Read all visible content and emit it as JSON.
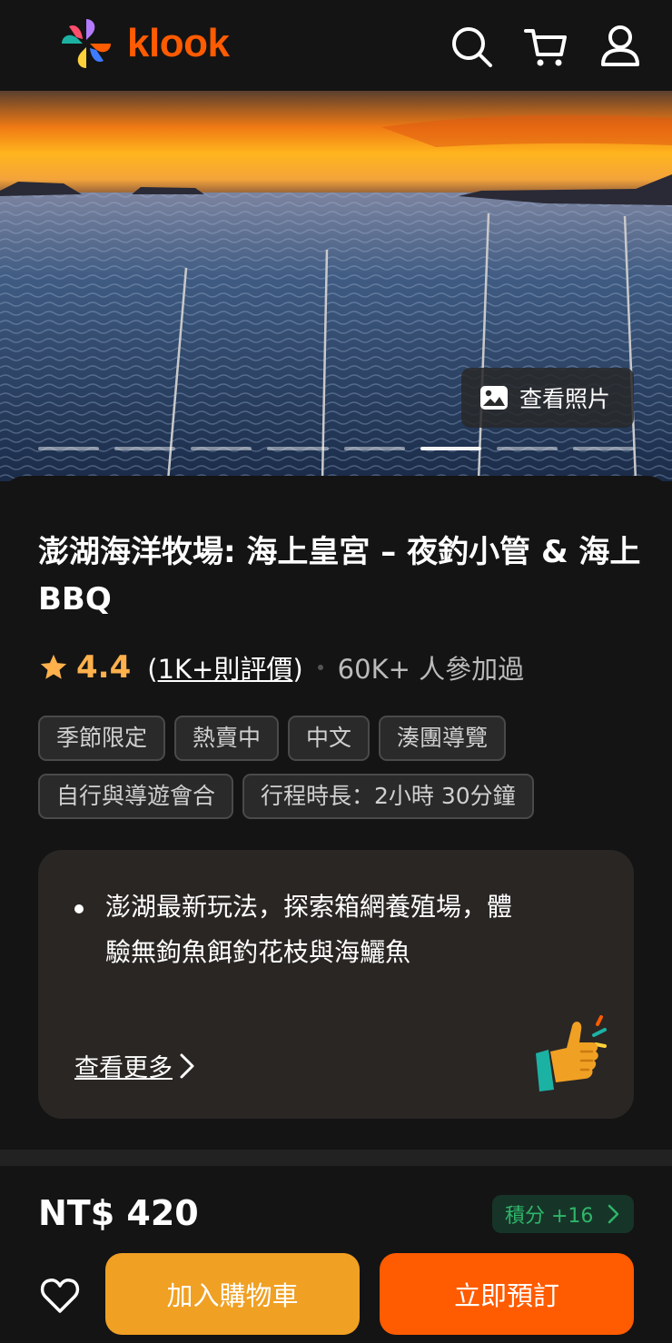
{
  "header": {
    "brand": "klook",
    "icons": [
      "search-icon",
      "cart-icon",
      "user-icon"
    ],
    "brand_color": "#ff5b00"
  },
  "hero": {
    "view_photos_label": "查看照片",
    "photo_count": 8,
    "active_photo": 6
  },
  "activity": {
    "title": "澎湖海洋牧場: 海上皇宮 – 夜釣小管 & 海上BBQ",
    "rating": "4.4",
    "reviews_open": "(",
    "reviews_link": "1K+則評價",
    "reviews_close": ")",
    "participants": "60K+ 人參加過",
    "tags": [
      "季節限定",
      "熱賣中",
      "中文",
      "湊團導覽",
      "自行與導遊會合",
      "行程時長：2小時 30分鐘"
    ]
  },
  "highlights": {
    "items": [
      "澎湖最新玩法，探索箱網養殖場，體驗無鉤魚餌釣花枝與海鱺魚"
    ],
    "see_more": "查看更多"
  },
  "booking": {
    "price": "NT$ 420",
    "points": "積分 +16",
    "add_to_cart": "加入購物車",
    "book_now": "立即預訂",
    "cart_color": "#f0a023",
    "book_color": "#ff5b00"
  }
}
